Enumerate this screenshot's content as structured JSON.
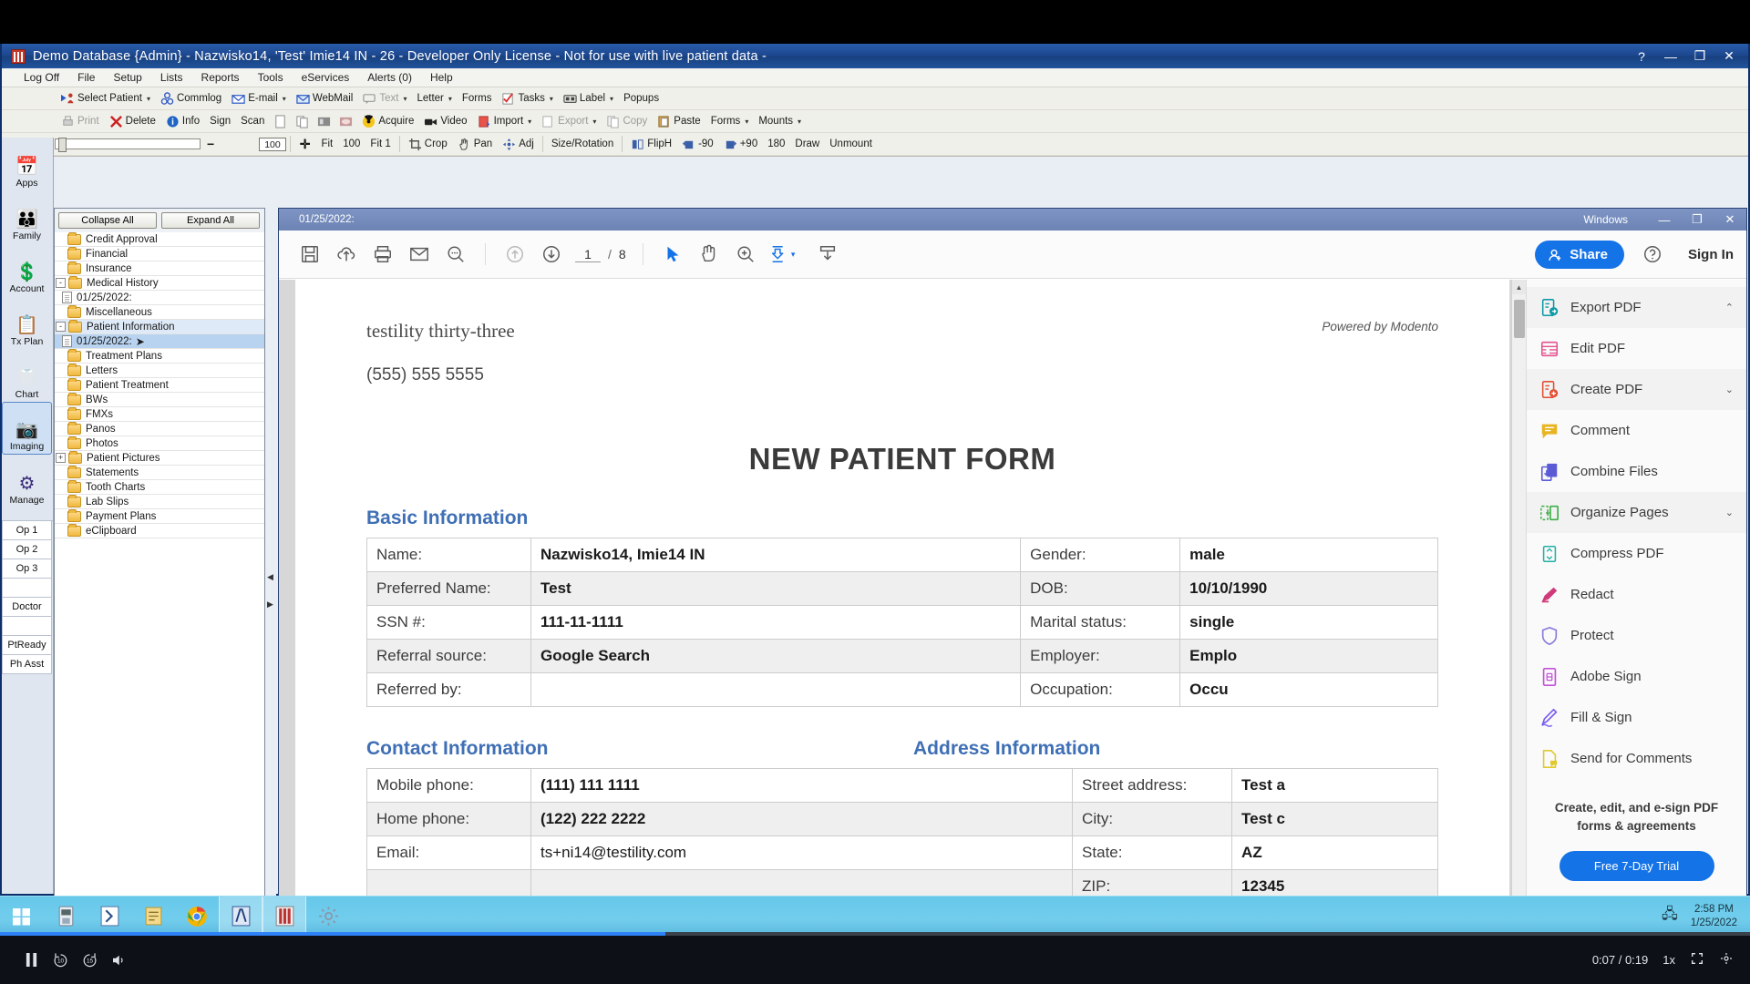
{
  "window": {
    "title": "Demo Database {Admin} - Nazwisko14, 'Test' Imie14 IN - 26 - Developer Only License - Not for use with live patient data -",
    "help_btn": "?",
    "minimize_btn": "—",
    "maximize_btn": "❐",
    "close_btn": "✕"
  },
  "menu": {
    "items": [
      "Log Off",
      "File",
      "Setup",
      "Lists",
      "Reports",
      "Tools",
      "eServices",
      "Alerts (0)",
      "Help"
    ]
  },
  "toolbar_row1": [
    {
      "label": "Select Patient",
      "caret": true
    },
    {
      "label": "Commlog",
      "caret": false
    },
    {
      "label": "E-mail",
      "caret": true
    },
    {
      "label": "WebMail",
      "caret": false
    },
    {
      "label": "Text",
      "caret": true,
      "dim": true
    },
    {
      "label": "Letter",
      "caret": true
    },
    {
      "label": "Forms",
      "caret": false
    },
    {
      "label": "Tasks",
      "caret": true
    },
    {
      "label": "Label",
      "caret": true
    },
    {
      "label": "Popups",
      "caret": false
    }
  ],
  "toolbar_row2": [
    {
      "label": "Print",
      "dim": true
    },
    {
      "label": "Delete",
      "dim": false
    },
    {
      "label": "Info",
      "dim": false
    },
    {
      "label": "Sign",
      "dim": false
    },
    {
      "label": "Scan",
      "dim": false
    },
    {
      "label": "Acquire",
      "dim": false
    },
    {
      "label": "Video",
      "dim": false
    },
    {
      "label": "Import",
      "caret": true
    },
    {
      "label": "Export",
      "caret": true,
      "dim": true
    },
    {
      "label": "Copy",
      "caret": false,
      "dim": true
    },
    {
      "label": "Paste",
      "caret": false
    },
    {
      "label": "Forms",
      "caret": true
    },
    {
      "label": "Mounts",
      "caret": true
    }
  ],
  "toolbar_row3": {
    "zoom_value": "100",
    "items": [
      "Fit",
      "100",
      "Fit 1",
      "Crop",
      "Pan",
      "Adj",
      "Size/Rotation",
      "FlipH",
      "-90",
      "+90",
      "180",
      "Draw",
      "Unmount"
    ]
  },
  "modules": [
    {
      "label": "Apps",
      "icon": "calendar-icon",
      "glyph": "📅",
      "active": false
    },
    {
      "label": "Family",
      "icon": "family-icon",
      "glyph": "👪",
      "active": false
    },
    {
      "label": "Account",
      "icon": "money-icon",
      "glyph": "💲",
      "active": false
    },
    {
      "label": "Tx Plan",
      "icon": "clipboard-icon",
      "glyph": "📋",
      "active": false
    },
    {
      "label": "Chart",
      "icon": "tooth-icon",
      "glyph": "🦷",
      "active": false
    },
    {
      "label": "Imaging",
      "icon": "camera-scanner-icon",
      "glyph": "📷",
      "active": true
    },
    {
      "label": "Manage",
      "icon": "gears-icon",
      "glyph": "⚙",
      "active": false
    }
  ],
  "op_buttons": [
    "Op 1",
    "Op 2",
    "Op 3",
    "",
    "Doctor",
    "",
    "PtReady",
    "Ph Asst"
  ],
  "tree": {
    "collapse_all": "Collapse All",
    "expand_all": "Expand All",
    "items": [
      {
        "label": "Credit Approval",
        "type": "folder",
        "expander": "",
        "selected": false
      },
      {
        "label": "Financial",
        "type": "folder",
        "expander": "",
        "selected": false
      },
      {
        "label": "Insurance",
        "type": "folder",
        "expander": "",
        "selected": false
      },
      {
        "label": "Medical History",
        "type": "folder",
        "expander": "-",
        "selected": false
      },
      {
        "label": "01/25/2022:",
        "type": "doc",
        "expander": "",
        "selected": false
      },
      {
        "label": "Miscellaneous",
        "type": "folder",
        "expander": "",
        "selected": false
      },
      {
        "label": "Patient Information",
        "type": "folder",
        "expander": "-",
        "selected": false
      },
      {
        "label": "01/25/2022:",
        "type": "doc",
        "expander": "",
        "selected": true
      },
      {
        "label": "Treatment Plans",
        "type": "folder",
        "expander": "",
        "selected": false
      },
      {
        "label": "Letters",
        "type": "folder",
        "expander": "",
        "selected": false
      },
      {
        "label": "Patient Treatment",
        "type": "folder",
        "expander": "",
        "selected": false
      },
      {
        "label": "BWs",
        "type": "folder",
        "expander": "",
        "selected": false
      },
      {
        "label": "FMXs",
        "type": "folder",
        "expander": "",
        "selected": false
      },
      {
        "label": "Panos",
        "type": "folder",
        "expander": "",
        "selected": false
      },
      {
        "label": "Photos",
        "type": "folder",
        "expander": "",
        "selected": false
      },
      {
        "label": "Patient Pictures",
        "type": "folder",
        "expander": "+",
        "selected": false
      },
      {
        "label": "Statements",
        "type": "folder",
        "expander": "",
        "selected": false
      },
      {
        "label": "Tooth Charts",
        "type": "folder",
        "expander": "",
        "selected": false
      },
      {
        "label": "Lab Slips",
        "type": "folder",
        "expander": "",
        "selected": false
      },
      {
        "label": "Payment Plans",
        "type": "folder",
        "expander": "",
        "selected": false
      },
      {
        "label": "eClipboard",
        "type": "folder",
        "expander": "",
        "selected": false
      }
    ]
  },
  "pdf_window": {
    "title": "01/25/2022:",
    "right_label": "Windows",
    "minimize": "—",
    "maximize": "❐",
    "close": "✕"
  },
  "acrobat_toolbar": {
    "page_current": "1",
    "page_sep": "/",
    "page_total": "8",
    "share_label": "Share",
    "signin_label": "Sign In",
    "icons": [
      "save-icon",
      "upload-cloud-icon",
      "print-icon",
      "email-icon",
      "search-icon",
      "previous-page-icon",
      "next-page-icon",
      "select-tool-icon",
      "hand-tool-icon",
      "zoom-in-icon",
      "page-fit-icon",
      "download-icon"
    ]
  },
  "document": {
    "clinic_name": "testility thirty-three",
    "powered_by": "Powered by Modento",
    "clinic_phone": "(555) 555 5555",
    "form_title": "NEW PATIENT FORM",
    "sections": {
      "basic": {
        "title": "Basic Information",
        "rows": [
          {
            "l1": "Name:",
            "v1": "Nazwisko14, Imie14 IN",
            "l2": "Gender:",
            "v2": "male"
          },
          {
            "l1": "Preferred Name:",
            "v1": "Test",
            "l2": "DOB:",
            "v2": "10/10/1990"
          },
          {
            "l1": "SSN #:",
            "v1": "111-11-1111",
            "l2": "Marital status:",
            "v2": "single"
          },
          {
            "l1": "Referral source:",
            "v1": "Google Search",
            "l2": "Employer:",
            "v2": "Emplo"
          },
          {
            "l1": "Referred by:",
            "v1": "",
            "l2": "Occupation:",
            "v2": "Occu"
          }
        ]
      },
      "contact": {
        "title": "Contact Information",
        "address_title": "Address Information",
        "rows": [
          {
            "l1": "Mobile phone:",
            "v1": "(111) 111 1111",
            "l2": "Street address:",
            "v2": "Test a"
          },
          {
            "l1": "Home phone:",
            "v1": "(122) 222 2222",
            "l2": "City:",
            "v2": "Test c"
          },
          {
            "l1": "Email:",
            "v1": "ts+ni14@testility.com",
            "l2": "State:",
            "v2": "AZ"
          },
          {
            "l1": "",
            "v1": "",
            "l2": "ZIP:",
            "v2": "12345"
          }
        ]
      }
    }
  },
  "tools_rail": {
    "items": [
      {
        "label": "Export PDF",
        "icon": "export-pdf-icon",
        "color": "#0e9aa7",
        "chevron": "up",
        "highlight": true
      },
      {
        "label": "Edit PDF",
        "icon": "edit-pdf-icon",
        "color": "#e5508f",
        "chevron": "",
        "highlight": false
      },
      {
        "label": "Create PDF",
        "icon": "create-pdf-icon",
        "color": "#e34f32",
        "chevron": "down",
        "highlight": true
      },
      {
        "label": "Comment",
        "icon": "comment-icon",
        "color": "#e8b423",
        "chevron": "",
        "highlight": false
      },
      {
        "label": "Combine Files",
        "icon": "combine-files-icon",
        "color": "#5b5bd6",
        "chevron": "",
        "highlight": false
      },
      {
        "label": "Organize Pages",
        "icon": "organize-pages-icon",
        "color": "#3fae49",
        "chevron": "down",
        "highlight": true
      },
      {
        "label": "Compress PDF",
        "icon": "compress-pdf-icon",
        "color": "#25b0a8",
        "chevron": "",
        "highlight": false
      },
      {
        "label": "Redact",
        "icon": "redact-icon",
        "color": "#cf3a7a",
        "chevron": "",
        "highlight": false
      },
      {
        "label": "Protect",
        "icon": "shield-icon",
        "color": "#8e7bdb",
        "chevron": "",
        "highlight": false
      },
      {
        "label": "Adobe Sign",
        "icon": "adobe-sign-icon",
        "color": "#c452d8",
        "chevron": "",
        "highlight": false
      },
      {
        "label": "Fill & Sign",
        "icon": "fill-and-sign-icon",
        "color": "#7a5cf0",
        "chevron": "",
        "highlight": false
      },
      {
        "label": "Send for Comments",
        "icon": "send-for-comments-icon",
        "color": "#e0c92e",
        "chevron": "",
        "highlight": false
      }
    ],
    "promo_text": "Create, edit, and e-sign PDF forms & agreements",
    "promo_button": "Free 7-Day Trial"
  },
  "taskbar": {
    "time": "2:58 PM",
    "date": "1/25/2022",
    "apps": [
      "start-icon",
      "file-explorer-icon",
      "code-icon",
      "notes-icon",
      "chrome-icon",
      "dentrix-icon",
      "imaging-icon",
      "settings-icon"
    ]
  },
  "video_player": {
    "play_state": "pause-icon",
    "rewind_label": "10",
    "forward_label": "15",
    "time": "0:07 / 0:19",
    "speed": "1x",
    "progress_percent": 38
  },
  "colors": {
    "accent_blue": "#1473e6",
    "title_blue": "#1d478f",
    "taskbar_cyan": "#72cdec",
    "section_heading": "#3f6fb5"
  }
}
